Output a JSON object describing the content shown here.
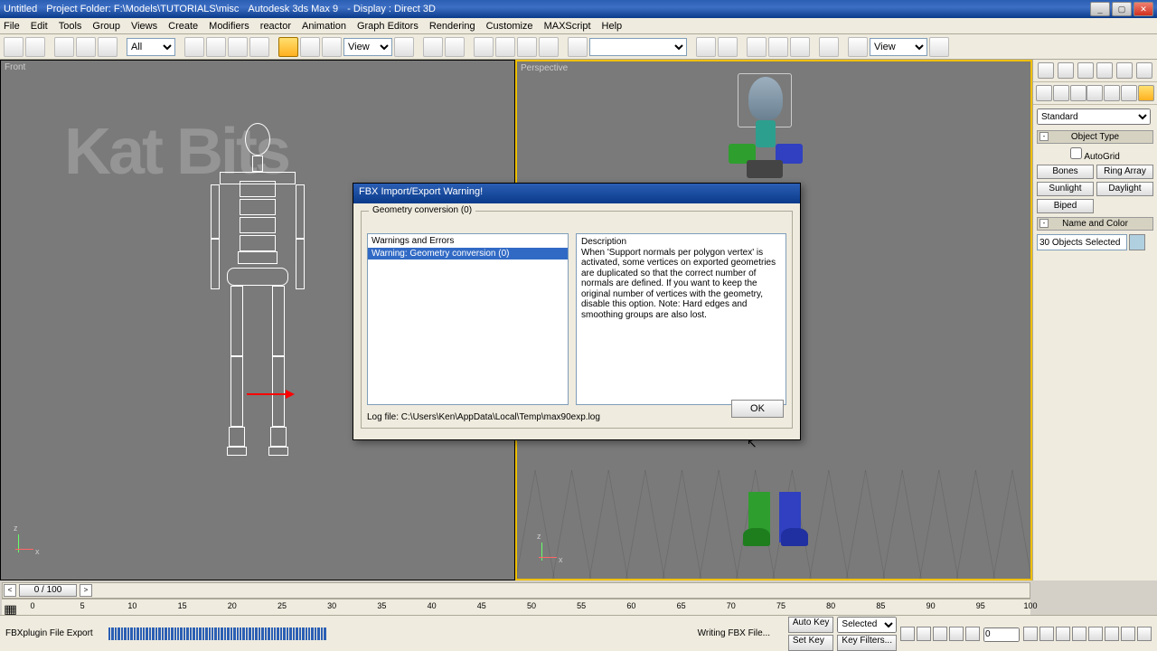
{
  "window": {
    "title_left": "Untitled",
    "title_mid": "Project Folder: F:\\Models\\TUTORIALS\\misc",
    "app": "Autodesk 3ds Max 9",
    "display": "- Display : Direct 3D"
  },
  "menus": [
    "File",
    "Edit",
    "Tools",
    "Group",
    "Views",
    "Create",
    "Modifiers",
    "reactor",
    "Animation",
    "Graph Editors",
    "Rendering",
    "Customize",
    "MAXScript",
    "Help"
  ],
  "toolbar": {
    "filter": "All",
    "ref1": "View",
    "ref2": "View"
  },
  "viewports": {
    "front": "Front",
    "perspective": "Perspective"
  },
  "cmdpanel": {
    "preset": "Standard",
    "object_type": "Object Type",
    "autogrid": "AutoGrid",
    "buttons": [
      "Bones",
      "Ring Array",
      "Sunlight",
      "Daylight",
      "Biped",
      ""
    ],
    "name_and_color": "Name and Color",
    "selected": "30 Objects Selected"
  },
  "dialog": {
    "title": "FBX Import/Export Warning!",
    "group": "Geometry conversion (0)",
    "warn_header": "Warnings and Errors",
    "desc_header": "Description",
    "warn_row": "Warning: Geometry conversion (0)",
    "desc_text": "When 'Support normals per polygon vertex' is activated, some vertices on exported geometries are duplicated so that the correct number of normals are defined. If you want to keep the original number of vertices with the geometry, disable this option. Note: Hard edges and smoothing groups are also lost.",
    "logfile": "Log file: C:\\Users\\Ken\\AppData\\Local\\Temp\\max90exp.log",
    "ok": "OK"
  },
  "timeline": {
    "handle": "0 / 100",
    "ticks": [
      0,
      5,
      10,
      15,
      20,
      25,
      30,
      35,
      40,
      45,
      50,
      55,
      60,
      65,
      70,
      75,
      80,
      85,
      90,
      95,
      100
    ]
  },
  "status": {
    "left": "FBXplugin File Export",
    "mid": "Writing FBX File...",
    "autokey": "Auto Key",
    "setkey": "Set Key",
    "keymode": "Selected",
    "keyfilters": "Key Filters...",
    "frame": "0"
  }
}
